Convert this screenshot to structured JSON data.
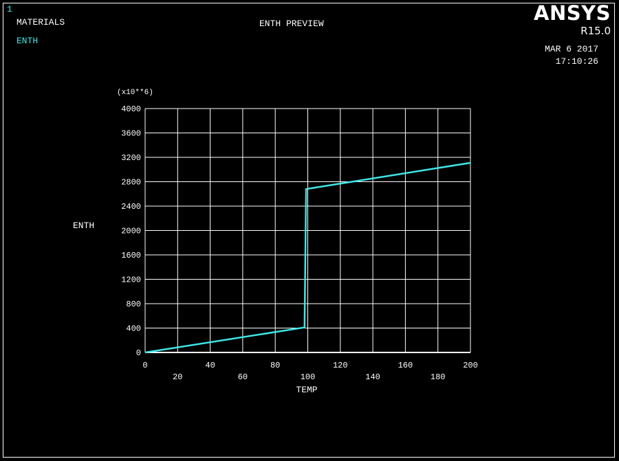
{
  "window": {
    "number": "1"
  },
  "header": {
    "context": "MATERIALS",
    "property": "ENTH",
    "title": "ENTH  PREVIEW",
    "logo": "ANSYS",
    "version": "R15.0",
    "date": "MAR  6 2017",
    "time": "17:10:26"
  },
  "colors": {
    "background": "#000000",
    "grid": "#ffffff",
    "curve": "#3fe6e6",
    "text": "#ffffff"
  },
  "chart_data": {
    "type": "line",
    "title": "ENTH  PREVIEW",
    "xlabel": "TEMP",
    "ylabel": "ENTH",
    "y_multiplier_label": "(x10**6)",
    "xlim": [
      0,
      200
    ],
    "ylim": [
      0,
      4000
    ],
    "x_ticks": [
      "0",
      "20",
      "40",
      "60",
      "80",
      "100",
      "120",
      "140",
      "160",
      "180",
      "200"
    ],
    "y_ticks": [
      "0",
      "400",
      "800",
      "1200",
      "1600",
      "2000",
      "2400",
      "2800",
      "3200",
      "3600",
      "4000"
    ],
    "grid": true,
    "series": [
      {
        "x": [
          0,
          98,
          99,
          200
        ],
        "y": [
          0,
          410,
          2680,
          3110
        ]
      }
    ]
  }
}
